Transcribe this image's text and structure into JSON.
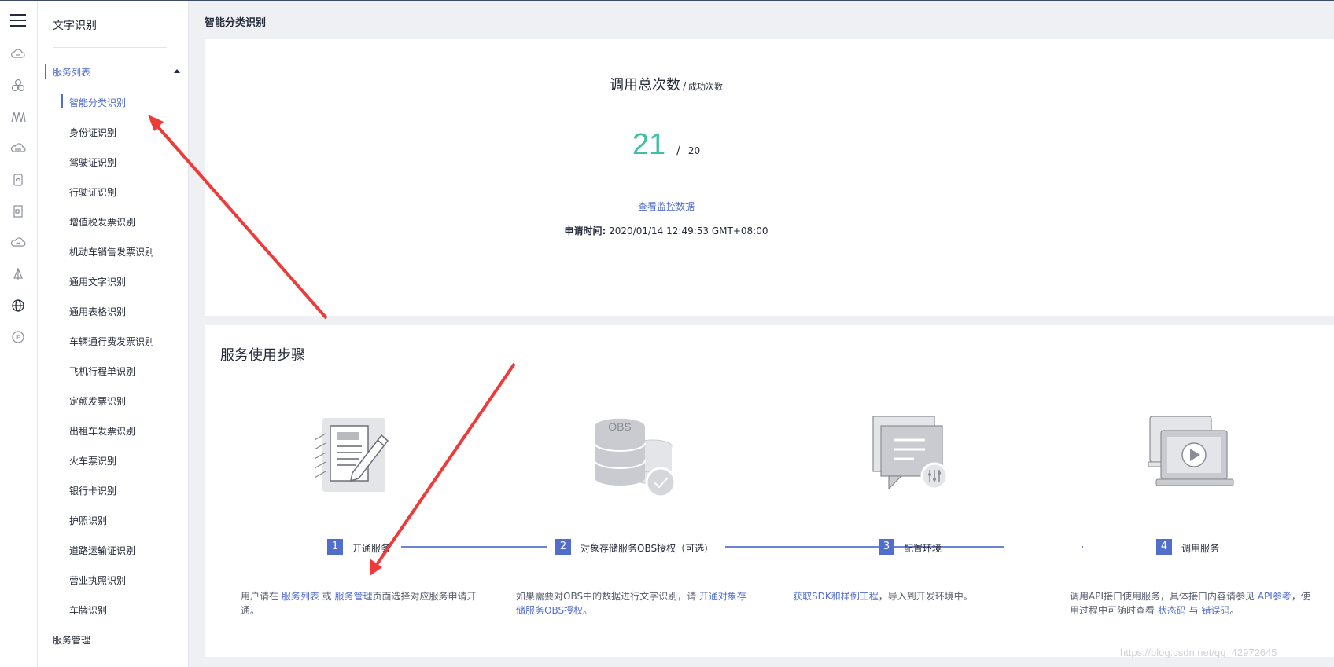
{
  "sidebar": {
    "title": "文字识别",
    "group_label": "服务列表",
    "items": [
      {
        "label": "智能分类识别",
        "active": true
      },
      {
        "label": "身份证识别"
      },
      {
        "label": "驾驶证识别"
      },
      {
        "label": "行驶证识别"
      },
      {
        "label": "增值税发票识别"
      },
      {
        "label": "机动车销售发票识别"
      },
      {
        "label": "通用文字识别"
      },
      {
        "label": "通用表格识别"
      },
      {
        "label": "车辆通行费发票识别"
      },
      {
        "label": "飞机行程单识别"
      },
      {
        "label": "定额发票识别"
      },
      {
        "label": "出租车发票识别"
      },
      {
        "label": "火车票识别"
      },
      {
        "label": "银行卡识别"
      },
      {
        "label": "护照识别"
      },
      {
        "label": "道路运输证识别"
      },
      {
        "label": "营业执照识别"
      },
      {
        "label": "车牌识别"
      }
    ],
    "management_label": "服务管理"
  },
  "main": {
    "page_title": "智能分类识别",
    "stats": {
      "total_label": "调用总次数",
      "separator": "/",
      "success_label": "成功次数",
      "total_value": "21",
      "value_separator": "/",
      "success_value": "20",
      "monitor_link": "查看监控数据",
      "apply_time_label": "申请时间:",
      "apply_time_value": "2020/01/14 12:49:53 GMT+08:00"
    },
    "steps": {
      "title": "服务使用步骤",
      "items": [
        {
          "num": "1",
          "label": "开通服务",
          "desc_1": "用户请在 ",
          "link_1": "服务列表",
          "desc_2": " 或 ",
          "link_2": "服务管理",
          "desc_3": "页面选择对应服务申请开通。"
        },
        {
          "num": "2",
          "label": "对象存储服务OBS授权（可选）",
          "desc_1": "如果需要对OBS中的数据进行文字识别，请 ",
          "link_1": "开通对象存储服务OBS授权",
          "desc_2": "。"
        },
        {
          "num": "3",
          "label": "配置环境",
          "link_1": "获取SDK和样例工程",
          "desc_1": "，导入到开发环境中。"
        },
        {
          "num": "4",
          "label": "调用服务",
          "desc_1": "调用API接口使用服务，具体接口内容请参见 ",
          "link_1": "API参考",
          "desc_2": "，使用过程中可随时查看 ",
          "link_2": "状态码",
          "desc_3": " 与 ",
          "link_3": "错误码",
          "desc_4": "。"
        }
      ],
      "obs_label": "OBS"
    }
  },
  "watermark": "https://blog.csdn.net/qq_42972645",
  "colors": {
    "accent": "#526ecc",
    "success_number": "#3fc0a0",
    "annotation_arrow": "#f03a3a"
  }
}
